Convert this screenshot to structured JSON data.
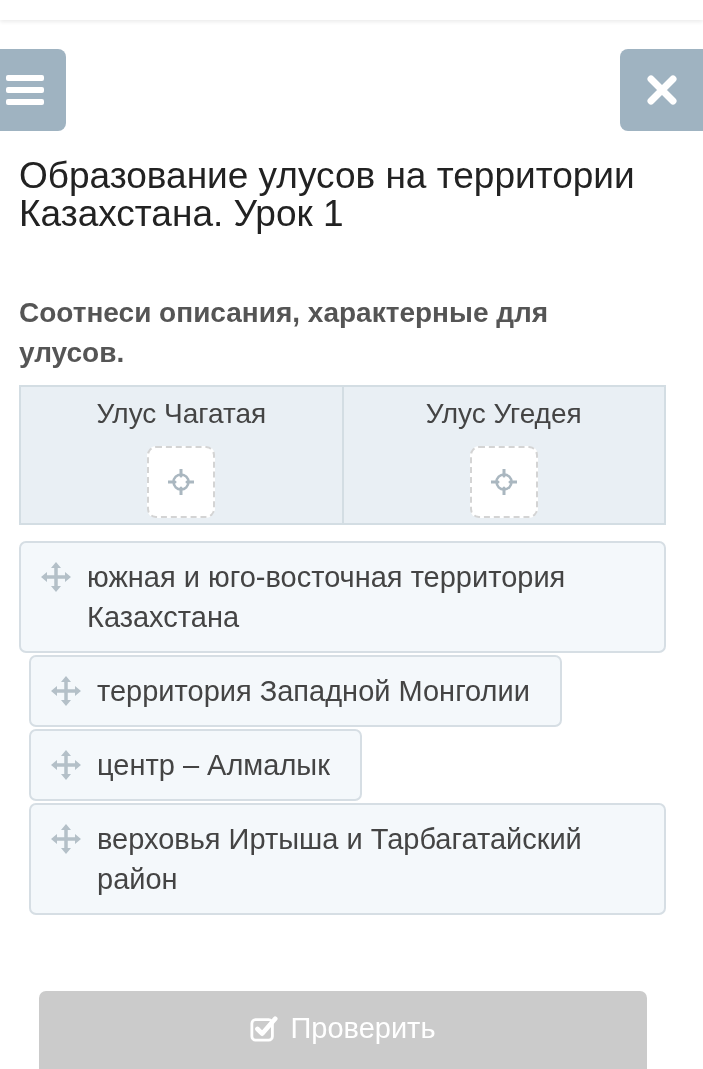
{
  "title": "Образование улусов на территории Казахстана. Урок 1",
  "question": "Соотнеси описания, характерные для улусов.",
  "categories": [
    {
      "label": "Улус Чагатая"
    },
    {
      "label": "Улус Угедея"
    }
  ],
  "items": [
    {
      "text": "южная и юго-восточная территория Казахстана"
    },
    {
      "text": "территория Западной Монголии"
    },
    {
      "text": "центр – Алмалык"
    },
    {
      "text": "верховья Иртыша и Тарбагатайский район"
    }
  ],
  "check_button": {
    "label": "Проверить",
    "disabled": true
  }
}
